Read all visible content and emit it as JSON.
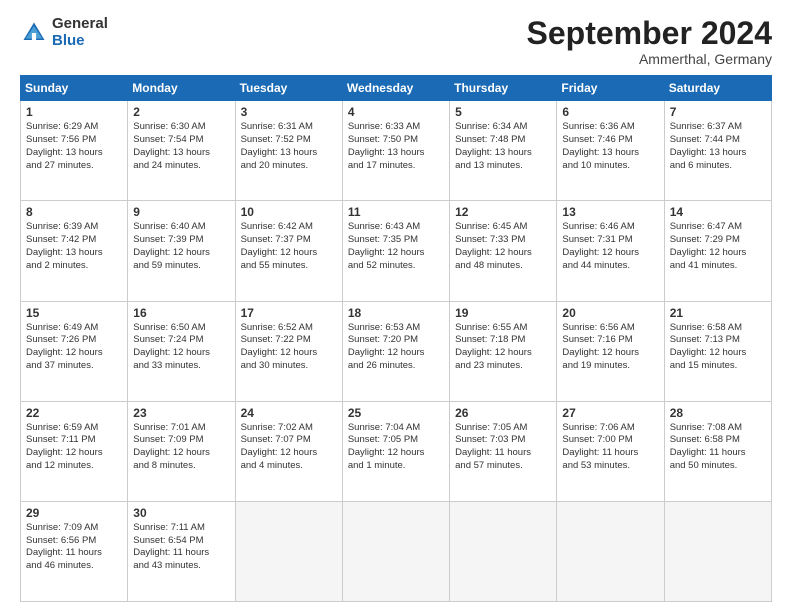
{
  "header": {
    "logo": {
      "general": "General",
      "blue": "Blue"
    },
    "title": "September 2024",
    "subtitle": "Ammerthal, Germany"
  },
  "calendar": {
    "days_of_week": [
      "Sunday",
      "Monday",
      "Tuesday",
      "Wednesday",
      "Thursday",
      "Friday",
      "Saturday"
    ],
    "weeks": [
      [
        {
          "num": "",
          "info": ""
        },
        {
          "num": "2",
          "info": "Sunrise: 6:30 AM\nSunset: 7:54 PM\nDaylight: 13 hours\nand 24 minutes."
        },
        {
          "num": "3",
          "info": "Sunrise: 6:31 AM\nSunset: 7:52 PM\nDaylight: 13 hours\nand 20 minutes."
        },
        {
          "num": "4",
          "info": "Sunrise: 6:33 AM\nSunset: 7:50 PM\nDaylight: 13 hours\nand 17 minutes."
        },
        {
          "num": "5",
          "info": "Sunrise: 6:34 AM\nSunset: 7:48 PM\nDaylight: 13 hours\nand 13 minutes."
        },
        {
          "num": "6",
          "info": "Sunrise: 6:36 AM\nSunset: 7:46 PM\nDaylight: 13 hours\nand 10 minutes."
        },
        {
          "num": "7",
          "info": "Sunrise: 6:37 AM\nSunset: 7:44 PM\nDaylight: 13 hours\nand 6 minutes."
        }
      ],
      [
        {
          "num": "8",
          "info": "Sunrise: 6:39 AM\nSunset: 7:42 PM\nDaylight: 13 hours\nand 2 minutes."
        },
        {
          "num": "9",
          "info": "Sunrise: 6:40 AM\nSunset: 7:39 PM\nDaylight: 12 hours\nand 59 minutes."
        },
        {
          "num": "10",
          "info": "Sunrise: 6:42 AM\nSunset: 7:37 PM\nDaylight: 12 hours\nand 55 minutes."
        },
        {
          "num": "11",
          "info": "Sunrise: 6:43 AM\nSunset: 7:35 PM\nDaylight: 12 hours\nand 52 minutes."
        },
        {
          "num": "12",
          "info": "Sunrise: 6:45 AM\nSunset: 7:33 PM\nDaylight: 12 hours\nand 48 minutes."
        },
        {
          "num": "13",
          "info": "Sunrise: 6:46 AM\nSunset: 7:31 PM\nDaylight: 12 hours\nand 44 minutes."
        },
        {
          "num": "14",
          "info": "Sunrise: 6:47 AM\nSunset: 7:29 PM\nDaylight: 12 hours\nand 41 minutes."
        }
      ],
      [
        {
          "num": "15",
          "info": "Sunrise: 6:49 AM\nSunset: 7:26 PM\nDaylight: 12 hours\nand 37 minutes."
        },
        {
          "num": "16",
          "info": "Sunrise: 6:50 AM\nSunset: 7:24 PM\nDaylight: 12 hours\nand 33 minutes."
        },
        {
          "num": "17",
          "info": "Sunrise: 6:52 AM\nSunset: 7:22 PM\nDaylight: 12 hours\nand 30 minutes."
        },
        {
          "num": "18",
          "info": "Sunrise: 6:53 AM\nSunset: 7:20 PM\nDaylight: 12 hours\nand 26 minutes."
        },
        {
          "num": "19",
          "info": "Sunrise: 6:55 AM\nSunset: 7:18 PM\nDaylight: 12 hours\nand 23 minutes."
        },
        {
          "num": "20",
          "info": "Sunrise: 6:56 AM\nSunset: 7:16 PM\nDaylight: 12 hours\nand 19 minutes."
        },
        {
          "num": "21",
          "info": "Sunrise: 6:58 AM\nSunset: 7:13 PM\nDaylight: 12 hours\nand 15 minutes."
        }
      ],
      [
        {
          "num": "22",
          "info": "Sunrise: 6:59 AM\nSunset: 7:11 PM\nDaylight: 12 hours\nand 12 minutes."
        },
        {
          "num": "23",
          "info": "Sunrise: 7:01 AM\nSunset: 7:09 PM\nDaylight: 12 hours\nand 8 minutes."
        },
        {
          "num": "24",
          "info": "Sunrise: 7:02 AM\nSunset: 7:07 PM\nDaylight: 12 hours\nand 4 minutes."
        },
        {
          "num": "25",
          "info": "Sunrise: 7:04 AM\nSunset: 7:05 PM\nDaylight: 12 hours\nand 1 minute."
        },
        {
          "num": "26",
          "info": "Sunrise: 7:05 AM\nSunset: 7:03 PM\nDaylight: 11 hours\nand 57 minutes."
        },
        {
          "num": "27",
          "info": "Sunrise: 7:06 AM\nSunset: 7:00 PM\nDaylight: 11 hours\nand 53 minutes."
        },
        {
          "num": "28",
          "info": "Sunrise: 7:08 AM\nSunset: 6:58 PM\nDaylight: 11 hours\nand 50 minutes."
        }
      ],
      [
        {
          "num": "29",
          "info": "Sunrise: 7:09 AM\nSunset: 6:56 PM\nDaylight: 11 hours\nand 46 minutes."
        },
        {
          "num": "30",
          "info": "Sunrise: 7:11 AM\nSunset: 6:54 PM\nDaylight: 11 hours\nand 43 minutes."
        },
        {
          "num": "",
          "info": ""
        },
        {
          "num": "",
          "info": ""
        },
        {
          "num": "",
          "info": ""
        },
        {
          "num": "",
          "info": ""
        },
        {
          "num": "",
          "info": ""
        }
      ]
    ],
    "week1_sunday": {
      "num": "1",
      "info": "Sunrise: 6:29 AM\nSunset: 7:56 PM\nDaylight: 13 hours\nand 27 minutes."
    }
  }
}
